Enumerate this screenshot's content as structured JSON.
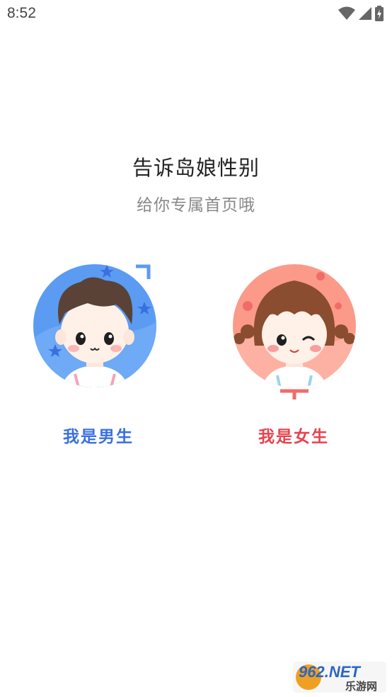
{
  "status_bar": {
    "time": "8:52",
    "icons": [
      "wifi-icon",
      "signal-icon",
      "battery-charging-icon"
    ]
  },
  "header": {
    "title": "告诉岛娘性别",
    "subtitle": "给你专属首页哦"
  },
  "options": {
    "male": {
      "label": "我是男生",
      "color": "#3a6fe0"
    },
    "female": {
      "label": "我是女生",
      "color": "#e8434f"
    }
  },
  "watermark": {
    "brand": "962.NET",
    "caption": "乐游网"
  }
}
